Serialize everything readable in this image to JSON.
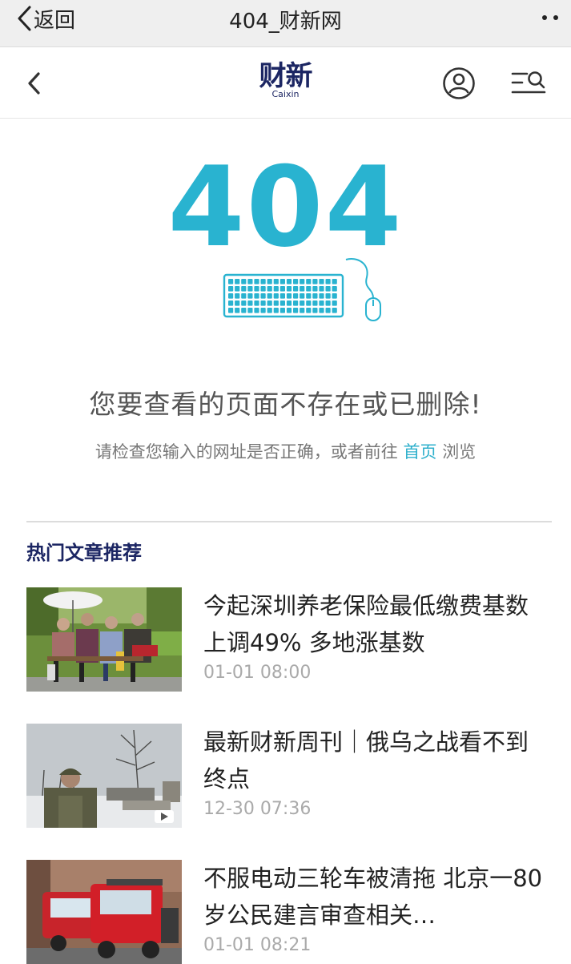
{
  "wechat_bar": {
    "back_label": "返回",
    "title": "404_财新网"
  },
  "header": {
    "logo_cn": "财新",
    "logo_en": "Caixin",
    "icons": [
      "back-chevron-icon",
      "user-icon",
      "search-menu-icon"
    ]
  },
  "error": {
    "code": "404",
    "title": "您要查看的页面不存在或已删除!",
    "hint_before": "请检查您输入的网址是否正确，或者前往",
    "home_link": "首页",
    "hint_after": "浏览"
  },
  "colors": {
    "accent": "#29b3d0",
    "brand": "#1c2663",
    "link": "#2fb0cc"
  },
  "section": {
    "title": "热门文章推荐"
  },
  "articles": [
    {
      "title": "今起深圳养老保险最低缴费基数上调49% 多地涨基数",
      "time": "01-01 08:00",
      "image": "elderly-people-on-bench-photo"
    },
    {
      "title": "最新财新周刊｜俄乌之战看不到终点",
      "time": "12-30 07:36",
      "image": "soldier-in-snow-photo",
      "video_badge": true
    },
    {
      "title": "不服电动三轮车被清拖 北京一80岁公民建言审查相关…",
      "time": "01-01 08:21",
      "image": "red-electric-tricycles-photo"
    }
  ]
}
